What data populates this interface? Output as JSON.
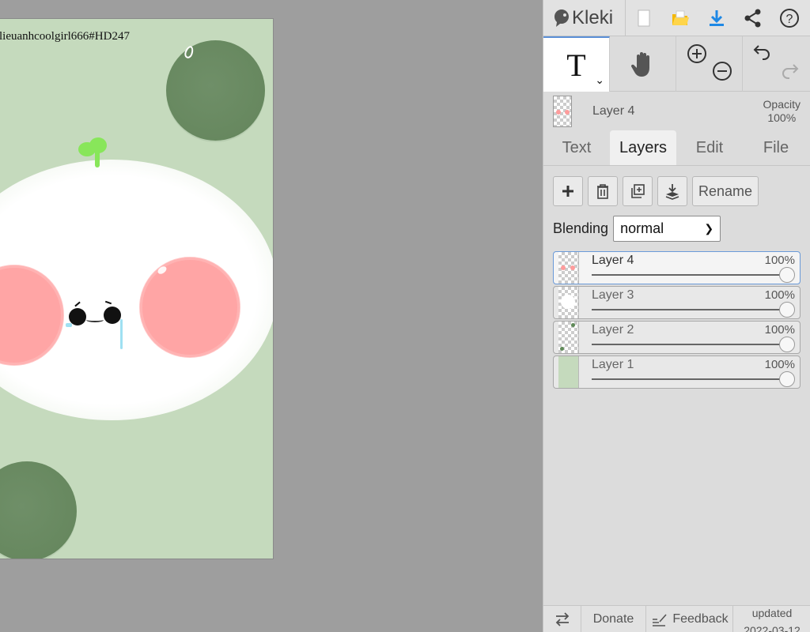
{
  "canvas": {
    "watermark": "lieuanhcoolgirl666#HD247"
  },
  "app": {
    "name": "Kleki"
  },
  "toolbar": {
    "text_tool_label": "T",
    "icons": [
      "new-file-icon",
      "open-folder-icon",
      "download-icon",
      "share-icon",
      "help-icon"
    ]
  },
  "current_layer": {
    "name": "Layer 4",
    "opacity_label": "Opacity",
    "opacity_value": "100%"
  },
  "tabs": [
    {
      "label": "Text"
    },
    {
      "label": "Layers"
    },
    {
      "label": "Edit"
    },
    {
      "label": "File"
    }
  ],
  "layer_actions": {
    "rename_label": "Rename"
  },
  "blending": {
    "label": "Blending",
    "value": "normal"
  },
  "layers": [
    {
      "name": "Layer 4",
      "opacity": "100%",
      "opacity_fraction": 1.0
    },
    {
      "name": "Layer 3",
      "opacity": "100%",
      "opacity_fraction": 1.0
    },
    {
      "name": "Layer 2",
      "opacity": "100%",
      "opacity_fraction": 1.0
    },
    {
      "name": "Layer 1",
      "opacity": "100%",
      "opacity_fraction": 1.0
    }
  ],
  "footer": {
    "donate_label": "Donate",
    "feedback_label": "Feedback",
    "updated_label": "updated",
    "updated_date": "2022-03-12"
  },
  "colors": {
    "accent": "#5b8fd6",
    "download": "#1e88e5",
    "folder": "#f5b800"
  }
}
